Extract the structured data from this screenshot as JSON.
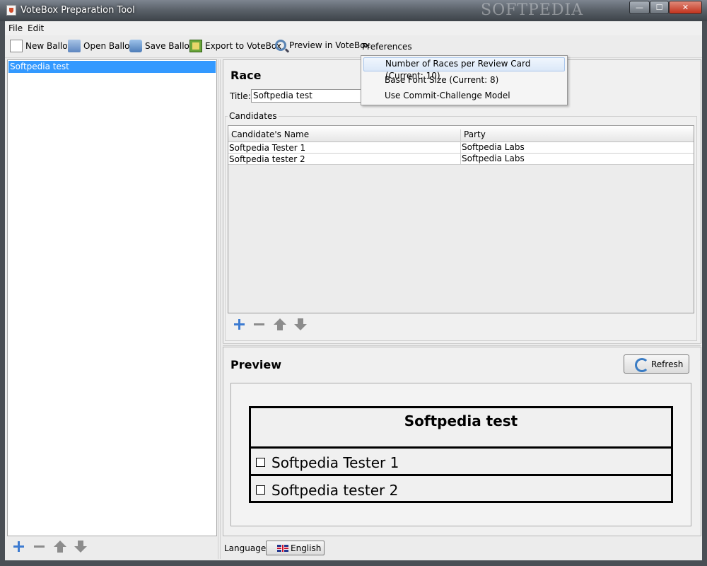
{
  "window": {
    "title": "VoteBox Preparation Tool",
    "watermark": "SOFTPEDIA",
    "min": "—",
    "max": "☐",
    "close": "✕"
  },
  "menubar": {
    "file": "File",
    "edit": "Edit"
  },
  "toolbar": {
    "new_ballot": "New Ballot",
    "open_ballot": "Open Ballot",
    "save_ballot": "Save Ballot",
    "export": "Export to VoteBox",
    "preview": "Preview in VoteBox",
    "preferences": "Preferences"
  },
  "preferences_menu": {
    "items": [
      "Number of Races per Review Card (Current: 10)",
      "Base Font Size (Current: 8)",
      "Use Commit-Challenge Model"
    ]
  },
  "left_list": {
    "items": [
      "Softpedia test"
    ]
  },
  "race": {
    "heading": "Race",
    "title_label": "Title:",
    "title_value": "Softpedia test",
    "candidates_label": "Candidates",
    "columns": [
      "Candidate's Name",
      "Party"
    ],
    "rows": [
      {
        "name": "Softpedia Tester 1",
        "party": "Softpedia Labs"
      },
      {
        "name": "Softpedia tester 2",
        "party": "Softpedia Labs"
      }
    ]
  },
  "preview": {
    "heading": "Preview",
    "refresh": "Refresh",
    "ballot_title": "Softpedia test",
    "ballot_rows": [
      "Softpedia Tester 1",
      "Softpedia tester 2"
    ]
  },
  "bottom": {
    "language_label": "Language:",
    "language": "English"
  },
  "colors": {
    "selection": "#3399ff",
    "accent_icon": "#3d7bd1"
  }
}
